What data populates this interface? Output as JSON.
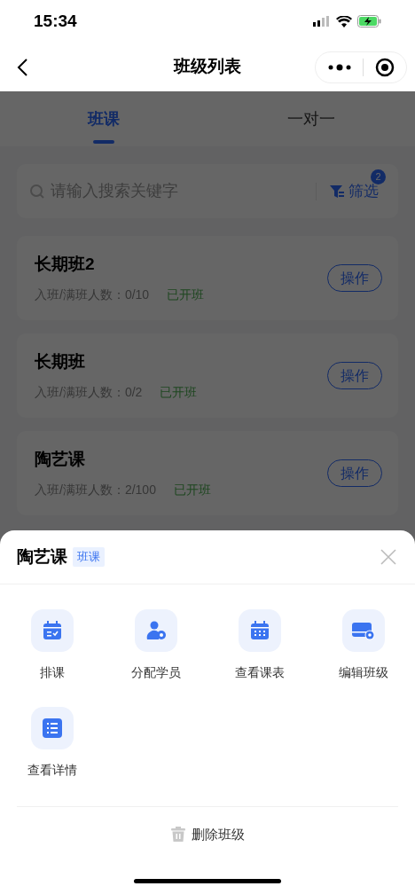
{
  "status_bar": {
    "time": "15:34"
  },
  "nav": {
    "title": "班级列表"
  },
  "tabs": [
    {
      "label": "班课",
      "selected": true
    },
    {
      "label": "一对一",
      "selected": false
    }
  ],
  "search": {
    "placeholder": "请输入搜索关键字",
    "filter_label": "筛选",
    "filter_count": "2"
  },
  "classes": [
    {
      "name": "长期班2",
      "enrollment_label": "入班/满班人数：",
      "enrollment": "0/10",
      "status": "已开班",
      "action": "操作"
    },
    {
      "name": "长期班",
      "enrollment_label": "入班/满班人数：",
      "enrollment": "0/2",
      "status": "已开班",
      "action": "操作"
    },
    {
      "name": "陶艺课",
      "enrollment_label": "入班/满班人数：",
      "enrollment": "2/100",
      "status": "已开班",
      "action": "操作"
    }
  ],
  "sheet": {
    "title": "陶艺课",
    "tag": "班课",
    "actions": [
      {
        "label": "排课"
      },
      {
        "label": "分配学员"
      },
      {
        "label": "查看课表"
      },
      {
        "label": "编辑班级"
      },
      {
        "label": "查看详情"
      }
    ],
    "delete_label": "删除班级"
  }
}
